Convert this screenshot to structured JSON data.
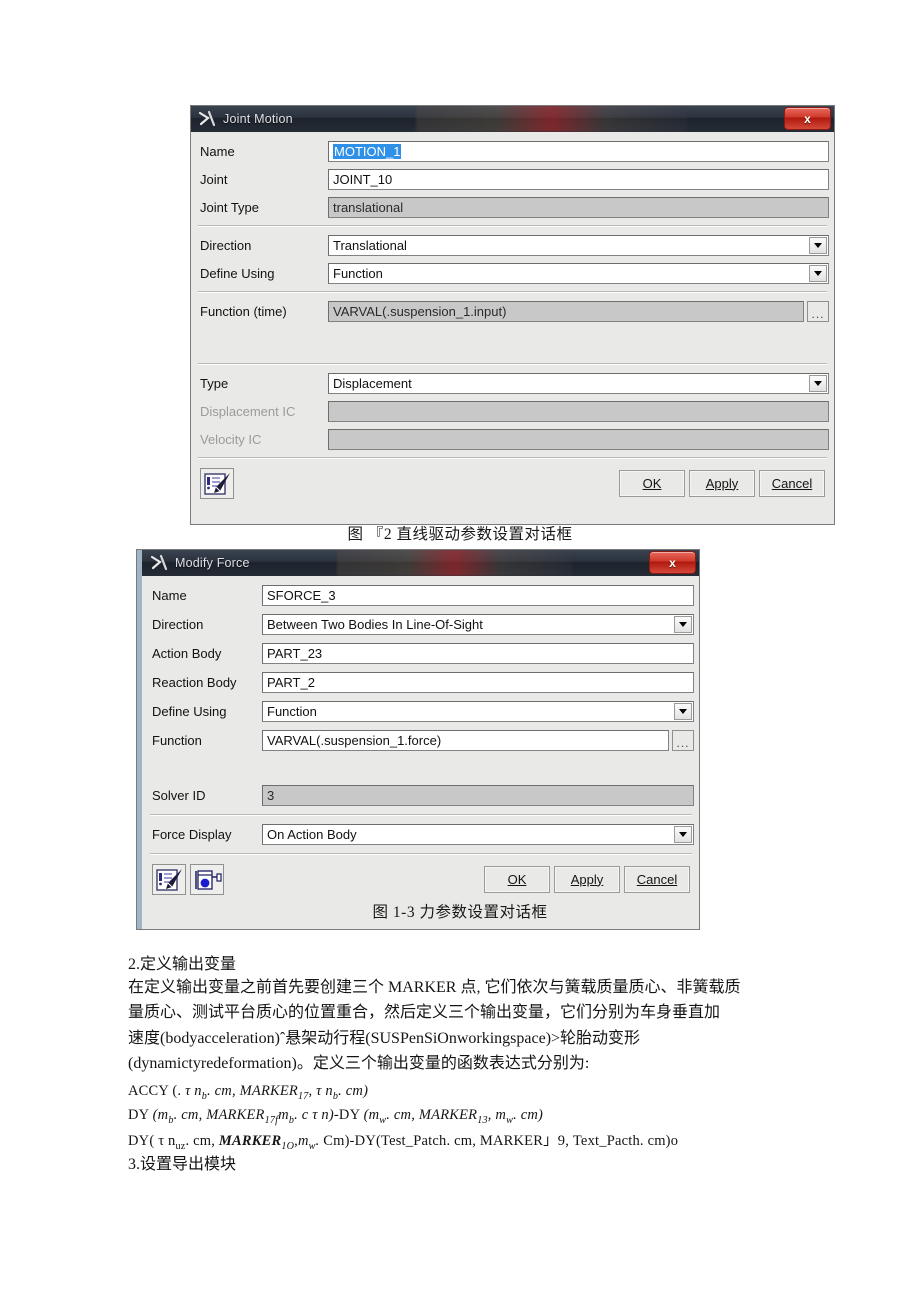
{
  "dialogs": [
    {
      "id": "joint-motion",
      "title": "Joint Motion",
      "close_label": "x",
      "rows": [
        {
          "label": "Name",
          "kind": "text",
          "value": "MOTION_1",
          "selected": true
        },
        {
          "label": "Joint",
          "kind": "text",
          "value": "JOINT_10"
        },
        {
          "label": "Joint Type",
          "kind": "readonly",
          "value": "translational"
        },
        {
          "label": "Direction",
          "kind": "combo",
          "value": "Translational"
        },
        {
          "label": "Define Using",
          "kind": "combo",
          "value": "Function"
        },
        {
          "label": "Function (time)",
          "kind": "readonly-ellipsis",
          "value": "VARVAL(.suspension_1.input)",
          "ellipsis": "..."
        },
        {
          "label": "Type",
          "kind": "combo",
          "value": "Displacement"
        },
        {
          "label": "Displacement IC",
          "kind": "readonly",
          "value": "",
          "dim_label": true
        },
        {
          "label": "Velocity IC",
          "kind": "readonly",
          "value": "",
          "dim_label": true
        }
      ],
      "tool_icons": [
        "edit-pen-icon"
      ],
      "buttons": [
        {
          "label": "OK",
          "underline": "O"
        },
        {
          "label": "Apply",
          "underline": "A"
        },
        {
          "label": "Cancel",
          "underline": "C"
        }
      ]
    },
    {
      "id": "modify-force",
      "title": "Modify Force",
      "close_label": "x",
      "rows": [
        {
          "label": "Name",
          "kind": "text",
          "value": "SFORCE_3"
        },
        {
          "label": "Direction",
          "kind": "combo",
          "value": "Between Two Bodies In Line-Of-Sight"
        },
        {
          "label": "Action Body",
          "kind": "text",
          "value": "PART_23"
        },
        {
          "label": "Reaction Body",
          "kind": "text",
          "value": "PART_2"
        },
        {
          "label": "Define Using",
          "kind": "combo",
          "value": "Function"
        },
        {
          "label": "Function",
          "kind": "text-ellipsis",
          "value": "VARVAL(.suspension_1.force)",
          "ellipsis": "..."
        },
        {
          "label": "Solver ID",
          "kind": "readonly",
          "value": "3"
        },
        {
          "label": "Force Display",
          "kind": "combo",
          "value": "On Action Body"
        }
      ],
      "tool_icons": [
        "edit-pen-icon",
        "force-marker-icon"
      ],
      "buttons": [
        {
          "label": "OK",
          "underline": "O"
        },
        {
          "label": "Apply",
          "underline": "A"
        },
        {
          "label": "Cancel",
          "underline": "C"
        }
      ]
    }
  ],
  "captions": {
    "figure_1_2": "图 『2 直线驱动参数设置对话框",
    "figure_1_3": "图 1-3 力参数设置对话框"
  },
  "body": {
    "heading_2": "2.定义输出变量",
    "paragraph_lines": [
      "在定义输出变量之前首先要创建三个 MARKER 点, 它们依次与簧载质量质心、非簧载质",
      "量质心、测试平台质心的位置重合，然后定义三个输出变量，它们分别为车身垂直加",
      "速度(bodyacceleration)ˆ悬架动行程(SUSPenSiOnworkingspace)>轮胎动变形",
      "(dynamictyredeformation)。定义三个输出变量的函数表达式分别为:"
    ],
    "formula_1": "ACCY (. τ n_b. cm, MARKER_17,  τ n_b. cm)",
    "formula_2": "DY (m_b. cm, MARKER_17f m_b. c τ n)-DY (m_w. cm, MARKER_13, m_w. cm)",
    "formula_3": "DY( τ n_uz. cm, MARKER_1O, m_w. Cm)-DY(Test_Patch. cm, MARKER」9, Text_Pacth. cm)o",
    "heading_3": "3.设置导出模块"
  },
  "colors": {
    "title_bar": "#262c36",
    "close_button": "#c8382a",
    "selection": "#2f90e8",
    "field_readonly": "#c8c8c8",
    "dialog_face": "#e9e9e7"
  }
}
